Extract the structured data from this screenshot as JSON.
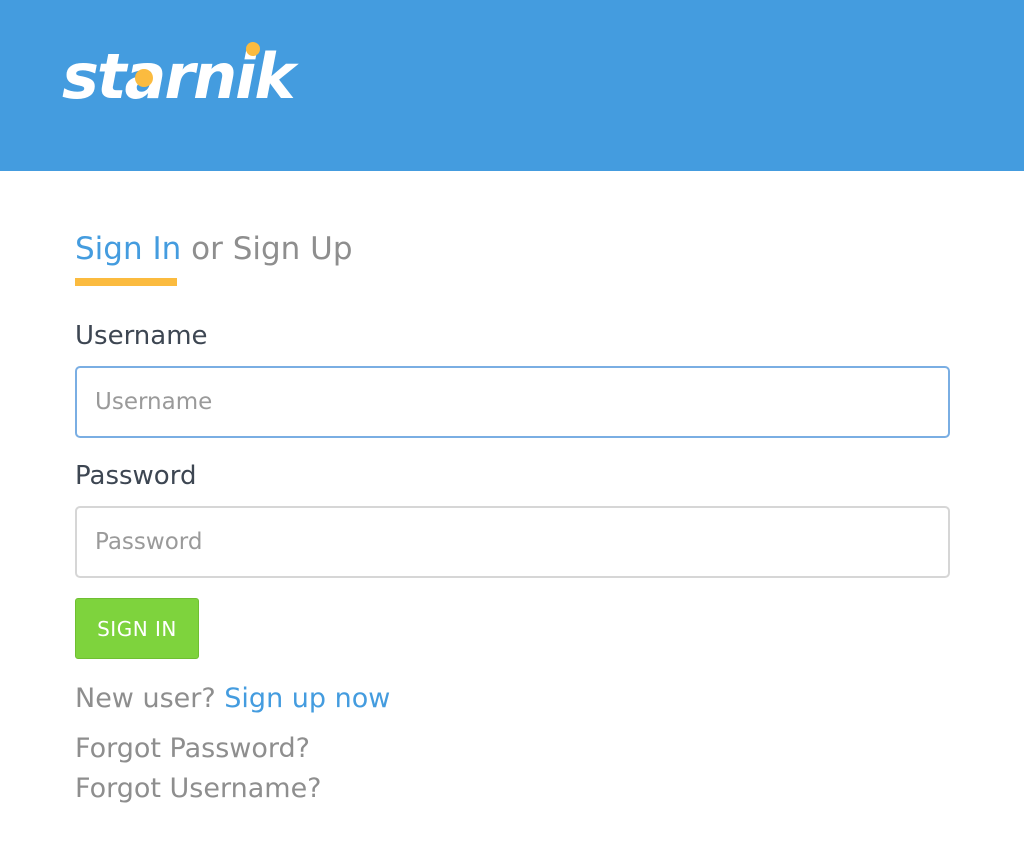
{
  "header": {
    "logo_text": "starnik",
    "background_color": "#449cdf",
    "logo_dot_color": "#fbbb3f"
  },
  "tabs": {
    "signin_label": "Sign In",
    "separator": "or",
    "signup_label": "Sign Up",
    "active": "Sign In"
  },
  "form": {
    "username_label": "Username",
    "username_placeholder": "Username",
    "username_value": "",
    "password_label": "Password",
    "password_placeholder": "Password",
    "password_value": "",
    "submit_label": "SIGN IN"
  },
  "footer": {
    "new_user_text": "New user?",
    "signup_link": "Sign up now",
    "forgot_password": "Forgot Password?",
    "forgot_username": "Forgot Username?"
  },
  "colors": {
    "accent": "#449cdf",
    "underline": "#fbbb3f",
    "button": "#7ed33d",
    "muted_text": "#8e8e8e",
    "label_text": "#3d4652"
  }
}
